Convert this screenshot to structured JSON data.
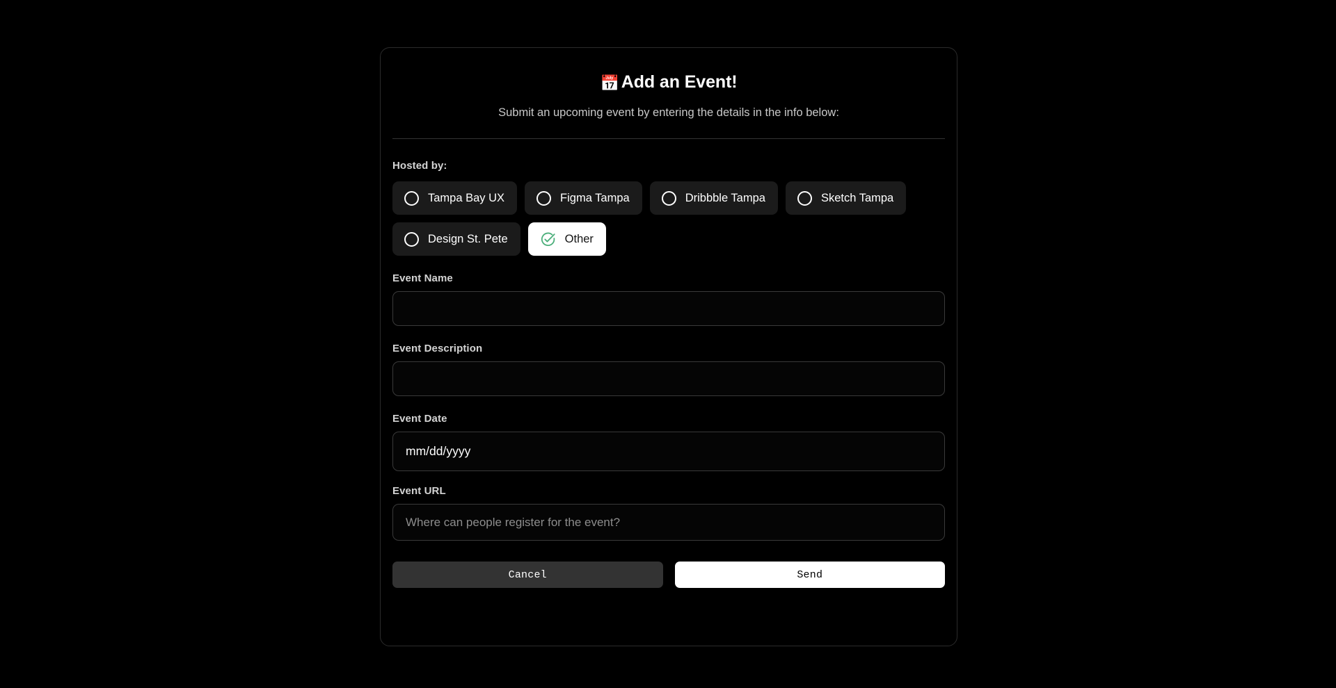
{
  "page": {
    "background_color": "#000000"
  },
  "card": {
    "title_emoji": "📅",
    "title": "Add an Event!",
    "subtitle": "Submit an upcoming event by entering the details in the info below:",
    "accent_green": "#4CAF7B",
    "selected_pill_bg": "#ffffff",
    "pill_bg": "#1b1b1b"
  },
  "hosted_by": {
    "label": "Hosted by:",
    "options": [
      {
        "label": "Tampa Bay UX",
        "selected": false,
        "icon": "radio-unchecked-icon"
      },
      {
        "label": "Figma Tampa",
        "selected": false,
        "icon": "radio-unchecked-icon"
      },
      {
        "label": "Dribbble Tampa",
        "selected": false,
        "icon": "radio-unchecked-icon"
      },
      {
        "label": "Sketch Tampa",
        "selected": false,
        "icon": "radio-unchecked-icon"
      },
      {
        "label": "Design St. Pete",
        "selected": false,
        "icon": "radio-unchecked-icon"
      },
      {
        "label": "Other",
        "selected": true,
        "icon": "check-circle-icon"
      }
    ]
  },
  "fields": {
    "event_name": {
      "label": "Event Name",
      "value": "",
      "placeholder": ""
    },
    "event_description": {
      "label": "Event Description",
      "value": "",
      "placeholder": ""
    },
    "event_date": {
      "label": "Event Date",
      "value": "",
      "placeholder": "mm/dd/yyyy"
    },
    "event_url": {
      "label": "Event URL",
      "value": "",
      "placeholder": "Where can people register for the event?"
    }
  },
  "actions": {
    "cancel_label": "Cancel",
    "send_label": "Send"
  }
}
